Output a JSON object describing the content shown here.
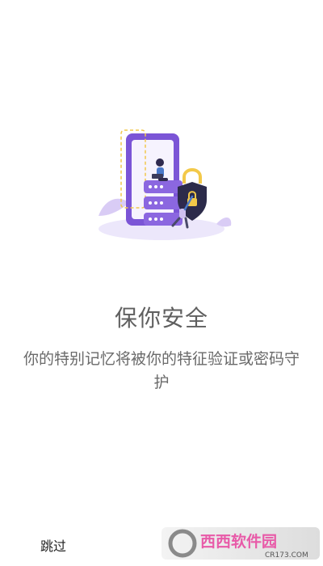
{
  "onboarding": {
    "title": "保你安全",
    "description": "你的特别记忆将被你的特征验证或密码守护"
  },
  "footer": {
    "skip_label": "跳过"
  },
  "watermark": {
    "brand_text": "西西软件园",
    "domain_text": "CR173.COM"
  },
  "colors": {
    "accent": "#7b55d6",
    "accent_light": "#cfc1f1",
    "lock": "#f3c949",
    "text_title": "#5f5f5f",
    "text_body": "#6a6a6a"
  }
}
